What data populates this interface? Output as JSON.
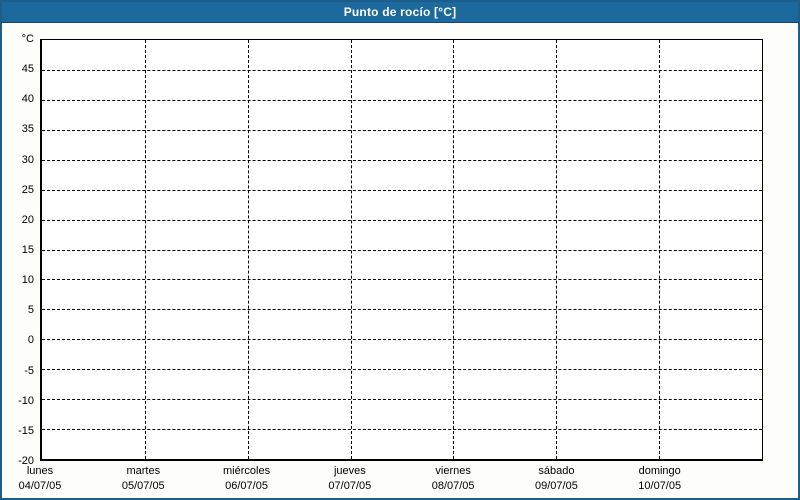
{
  "window": {
    "title": "Punto de rocío [°C]",
    "colors": {
      "titlebar_bg": "#1c699e",
      "window_border": "#1e5c8a",
      "title_text": "#ffffff",
      "content_bg": "#fdfefa",
      "plot_bg": "#ffffff",
      "grid_color": "#000000",
      "axis_text": "#000000"
    }
  },
  "chart_data": {
    "type": "line",
    "title": "Punto de rocío [°C]",
    "ylabel_unit": "°C",
    "ylim": [
      -20,
      50
    ],
    "y_tick_step": 5,
    "y_tick_labels": [
      "45",
      "40",
      "35",
      "30",
      "25",
      "20",
      "15",
      "10",
      "5",
      "0",
      "-5",
      "-10",
      "-15",
      "-20"
    ],
    "grid": "dashed",
    "legend": "none",
    "categories": [
      {
        "day": "lunes",
        "date": "04/07/05"
      },
      {
        "day": "martes",
        "date": "05/07/05"
      },
      {
        "day": "miércoles",
        "date": "06/07/05"
      },
      {
        "day": "jueves",
        "date": "07/07/05"
      },
      {
        "day": "viernes",
        "date": "08/07/05"
      },
      {
        "day": "sábado",
        "date": "09/07/05"
      },
      {
        "day": "domingo",
        "date": "10/07/05"
      }
    ],
    "series": []
  }
}
